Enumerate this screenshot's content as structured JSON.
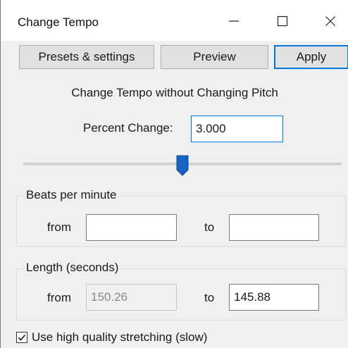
{
  "window": {
    "title": "Change Tempo"
  },
  "toolbar": {
    "presets_label": "Presets & settings",
    "preview_label": "Preview",
    "apply_label": "Apply"
  },
  "main": {
    "heading": "Change Tempo without Changing Pitch",
    "percent_change_label": "Percent Change:",
    "percent_change_value": "3.000",
    "slider_level_fraction": 0.5
  },
  "bpm_group": {
    "title": "Beats per minute",
    "from_label": "from",
    "from_value": "",
    "to_label": "to",
    "to_value": ""
  },
  "length_group": {
    "title": "Length (seconds)",
    "from_label": "from",
    "from_value": "150.26",
    "to_label": "to",
    "to_value": "145.88"
  },
  "options": {
    "high_quality_label": "Use high quality stretching (slow)",
    "high_quality_checked": true
  },
  "colors": {
    "accent": "#0078d7",
    "slider_thumb": "#1565c0"
  },
  "icons": {
    "minimize": "minimize-icon",
    "maximize": "maximize-icon",
    "close": "close-icon",
    "checkmark": "checkmark-icon"
  }
}
